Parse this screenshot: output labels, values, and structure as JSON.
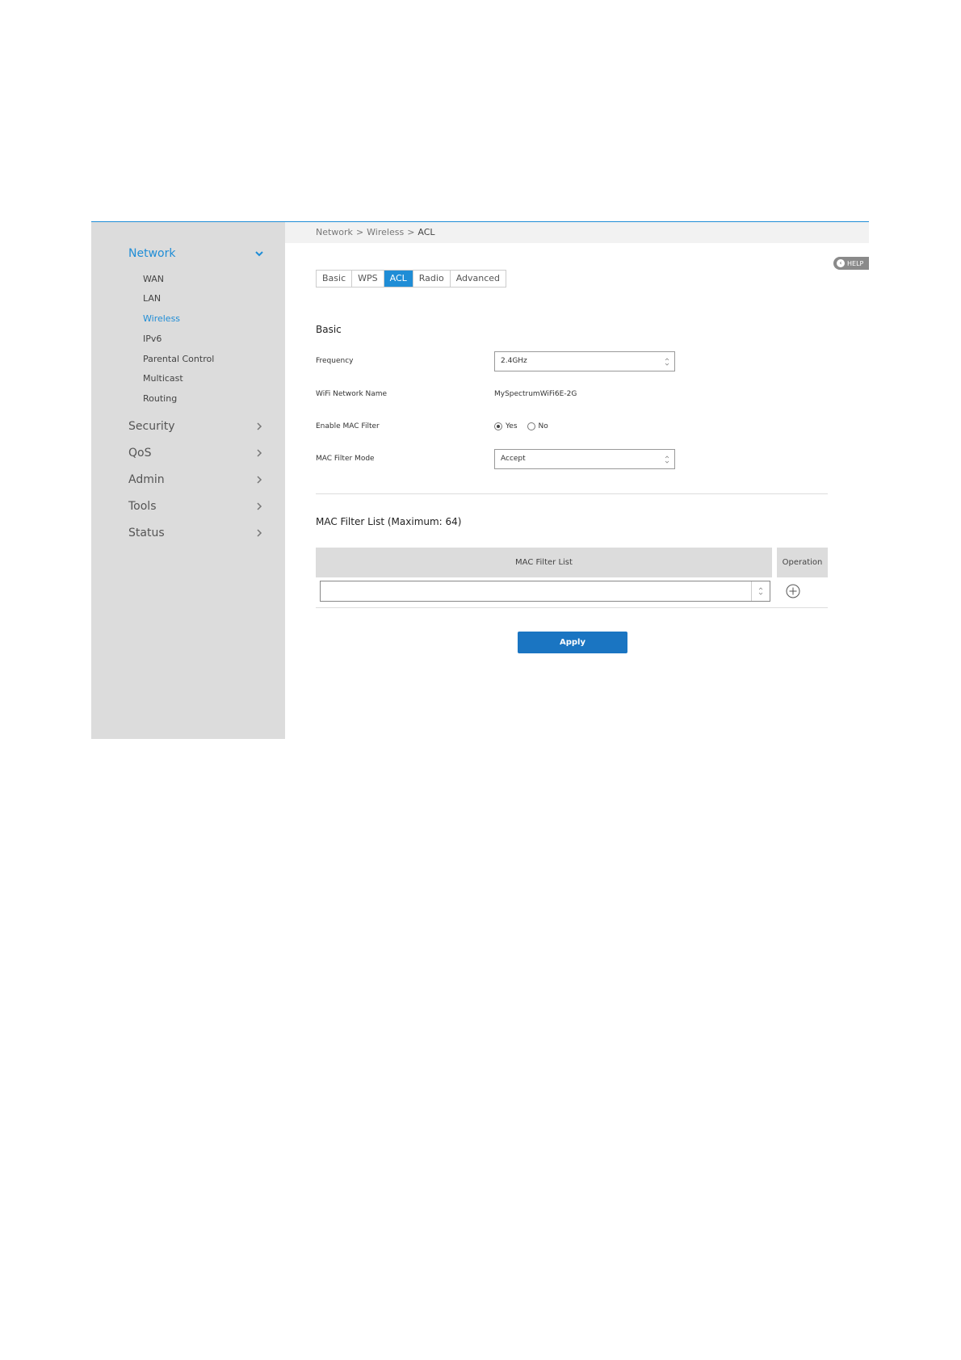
{
  "breadcrumb": {
    "items": [
      "Network",
      "Wireless",
      "ACL"
    ],
    "separator": ">"
  },
  "help": {
    "label": "HELP"
  },
  "sidebar": {
    "network": {
      "label": "Network",
      "subitems": [
        "WAN",
        "LAN",
        "Wireless",
        "IPv6",
        "Parental Control",
        "Multicast",
        "Routing"
      ],
      "active_subitem": "Wireless"
    },
    "items": [
      "Security",
      "QoS",
      "Admin",
      "Tools",
      "Status"
    ]
  },
  "tabs": [
    "Basic",
    "WPS",
    "ACL",
    "Radio",
    "Advanced"
  ],
  "active_tab": "ACL",
  "basic": {
    "title": "Basic",
    "frequency_label": "Frequency",
    "frequency_value": "2.4GHz",
    "wifi_name_label": "WiFi Network Name",
    "wifi_name_value": "MySpectrumWiFi6E-2G",
    "mac_filter_label": "Enable MAC Filter",
    "mac_filter_yes": "Yes",
    "mac_filter_no": "No",
    "mac_filter_selected": "Yes",
    "mode_label": "MAC Filter Mode",
    "mode_value": "Accept"
  },
  "mac_list": {
    "title": "MAC Filter List (Maximum: 64)",
    "col_list": "MAC Filter List",
    "col_operation": "Operation",
    "input_value": ""
  },
  "apply_label": "Apply",
  "colors": {
    "accent": "#1f8dd6",
    "apply": "#1a75c2",
    "sidebar_bg": "#dcdcdc"
  }
}
